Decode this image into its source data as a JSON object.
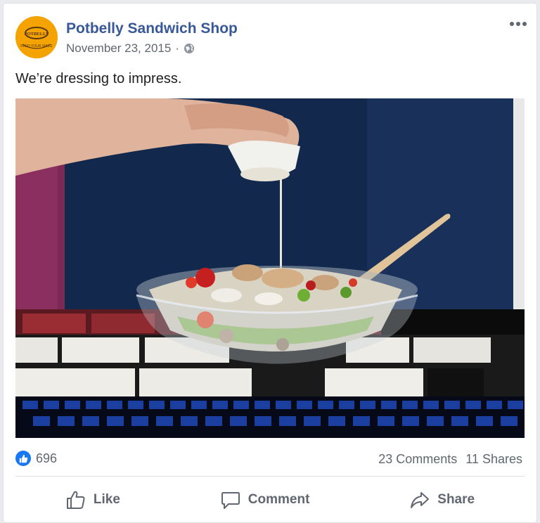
{
  "post": {
    "page_name": "Potbelly Sandwich Shop",
    "date": "November 23, 2015",
    "separator": "·",
    "privacy_icon": "globe-icon",
    "text": "We’re dressing to impress.",
    "photo_description_icon": "salad-photo"
  },
  "avatar": {
    "brand_text": "POTBELLY",
    "slogan": "FEED YOUR SMILE",
    "color": "#f4a300"
  },
  "stats": {
    "likes": "696",
    "comments": "23 Comments",
    "shares": "11 Shares"
  },
  "actions": {
    "like": "Like",
    "comment": "Comment",
    "share": "Share"
  },
  "colors": {
    "link": "#385898",
    "meta": "#606770",
    "like_blue": "#1877f2"
  }
}
